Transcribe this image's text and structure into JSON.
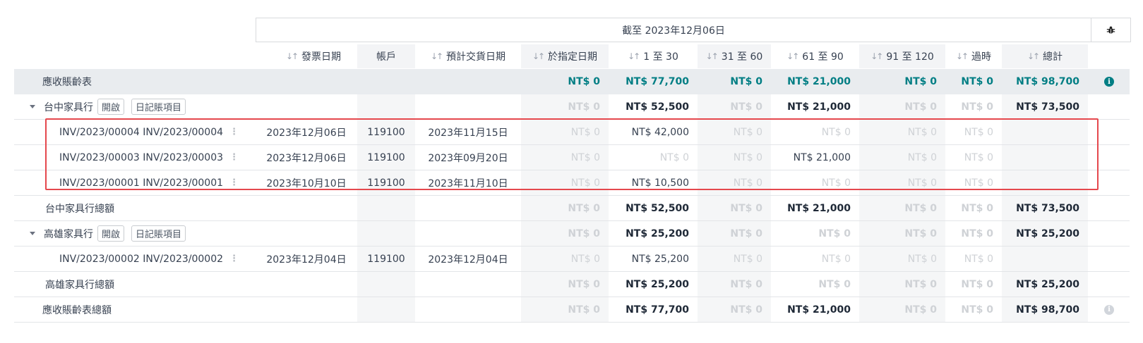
{
  "header": {
    "date_range": "截至 2023年12月06日",
    "columns": {
      "invoice_date": "發票日期",
      "account": "帳戶",
      "expected_date": "預計交貨日期",
      "as_of": "於指定日期",
      "d1_30": "1 至 30",
      "d31_60": "31 至 60",
      "d61_90": "61 至 90",
      "d91_120": "91 至 120",
      "older": "過時",
      "total": "總計"
    }
  },
  "report": {
    "title": "應收賬齡表",
    "as_of": "NT$ 0",
    "d1_30": "NT$ 77,700",
    "d31_60": "NT$ 0",
    "d61_90": "NT$ 21,000",
    "d91_120": "NT$ 0",
    "older": "NT$ 0",
    "total": "NT$ 98,700"
  },
  "partners": [
    {
      "name": "台中家具行",
      "open_label": "開啟",
      "journal_label": "日記賬項目",
      "as_of": "NT$ 0",
      "d1_30": "NT$ 52,500",
      "d31_60": "NT$ 0",
      "d61_90": "NT$ 21,000",
      "d91_120": "NT$ 0",
      "older": "NT$ 0",
      "total": "NT$ 73,500",
      "lines": [
        {
          "name": "INV/2023/00004 INV/2023/00004",
          "invoice_date": "2023年12月06日",
          "account": "119100",
          "expected_date": "2023年11月15日",
          "as_of": "NT$ 0",
          "d1_30": "NT$ 42,000",
          "d31_60": "NT$ 0",
          "d61_90": "NT$ 0",
          "d91_120": "NT$ 0",
          "older": "NT$ 0"
        },
        {
          "name": "INV/2023/00003 INV/2023/00003",
          "invoice_date": "2023年12月06日",
          "account": "119100",
          "expected_date": "2023年09月20日",
          "as_of": "NT$ 0",
          "d1_30": "NT$ 0",
          "d31_60": "NT$ 0",
          "d61_90": "NT$ 21,000",
          "d91_120": "NT$ 0",
          "older": "NT$ 0"
        },
        {
          "name": "INV/2023/00001 INV/2023/00001",
          "invoice_date": "2023年10月10日",
          "account": "119100",
          "expected_date": "2023年11月10日",
          "as_of": "NT$ 0",
          "d1_30": "NT$ 10,500",
          "d31_60": "NT$ 0",
          "d61_90": "NT$ 0",
          "d91_120": "NT$ 0",
          "older": "NT$ 0"
        }
      ],
      "total_label": "台中家具行總額",
      "totals": {
        "as_of": "NT$ 0",
        "d1_30": "NT$ 52,500",
        "d31_60": "NT$ 0",
        "d61_90": "NT$ 21,000",
        "d91_120": "NT$ 0",
        "older": "NT$ 0",
        "total": "NT$ 73,500"
      }
    },
    {
      "name": "高雄家具行",
      "open_label": "開啟",
      "journal_label": "日記賬項目",
      "as_of": "NT$ 0",
      "d1_30": "NT$ 25,200",
      "d31_60": "NT$ 0",
      "d61_90": "NT$ 0",
      "d91_120": "NT$ 0",
      "older": "NT$ 0",
      "total": "NT$ 25,200",
      "lines": [
        {
          "name": "INV/2023/00002 INV/2023/00002",
          "invoice_date": "2023年12月04日",
          "account": "119100",
          "expected_date": "2023年12月04日",
          "as_of": "NT$ 0",
          "d1_30": "NT$ 25,200",
          "d31_60": "NT$ 0",
          "d61_90": "NT$ 0",
          "d91_120": "NT$ 0",
          "older": "NT$ 0"
        }
      ],
      "total_label": "高雄家具行總額",
      "totals": {
        "as_of": "NT$ 0",
        "d1_30": "NT$ 25,200",
        "d31_60": "NT$ 0",
        "d61_90": "NT$ 0",
        "d91_120": "NT$ 0",
        "older": "NT$ 0",
        "total": "NT$ 25,200"
      }
    }
  ],
  "grand_total": {
    "label": "應收賬齡表總額",
    "as_of": "NT$ 0",
    "d1_30": "NT$ 77,700",
    "d31_60": "NT$ 0",
    "d61_90": "NT$ 21,000",
    "d91_120": "NT$ 0",
    "older": "NT$ 0",
    "total": "NT$ 98,700"
  },
  "colors": {
    "accent": "#017e84",
    "highlight": "#e5484d"
  },
  "icons": {
    "bug": "bug-icon",
    "info": "info-icon"
  }
}
